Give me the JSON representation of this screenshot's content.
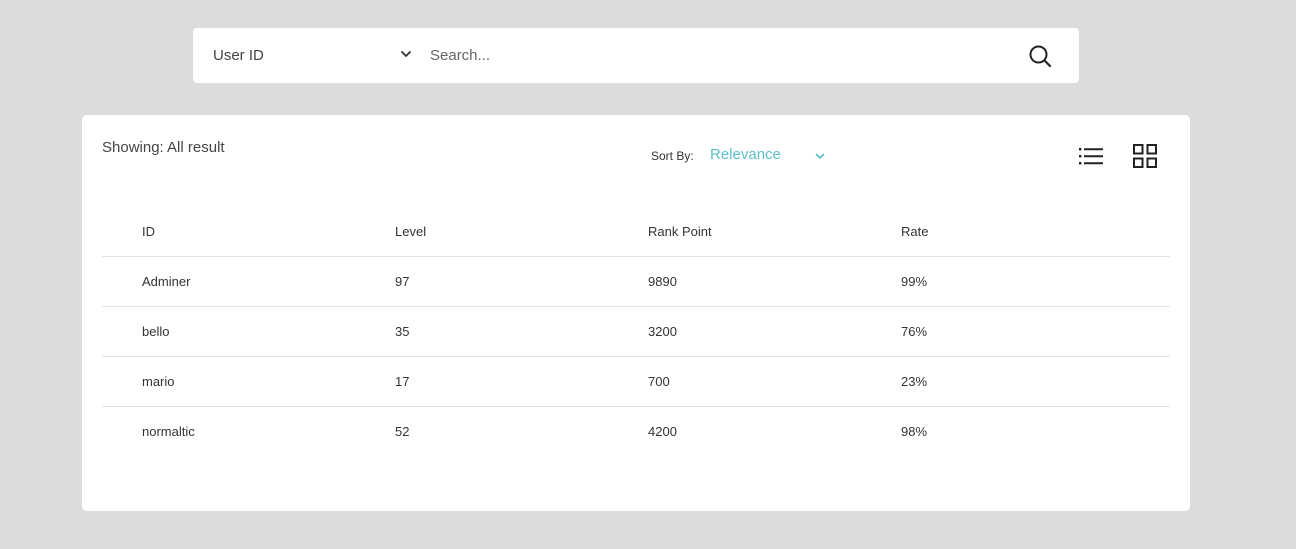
{
  "search": {
    "category": "User ID",
    "placeholder": "Search...",
    "value": ""
  },
  "results": {
    "showing": "Showing: All result",
    "sort_label": "Sort By:",
    "sort_value": "Relevance"
  },
  "table": {
    "headers": [
      "ID",
      "Level",
      "Rank Point",
      "Rate"
    ],
    "rows": [
      [
        "Adminer",
        "97",
        "9890",
        "99%"
      ],
      [
        "bello",
        "35",
        "3200",
        "76%"
      ],
      [
        "mario",
        "17",
        "700",
        "23%"
      ],
      [
        "normaltic",
        "52",
        "4200",
        "98%"
      ]
    ]
  },
  "icons": {
    "search": "search-icon",
    "category_dropdown": "chevron-down-icon",
    "sort_dropdown": "chevron-down-icon",
    "list_view": "list-view-icon",
    "grid_view": "grid-view-icon"
  },
  "colors": {
    "background": "#dcdcdc",
    "accent": "#5bbfc9"
  }
}
